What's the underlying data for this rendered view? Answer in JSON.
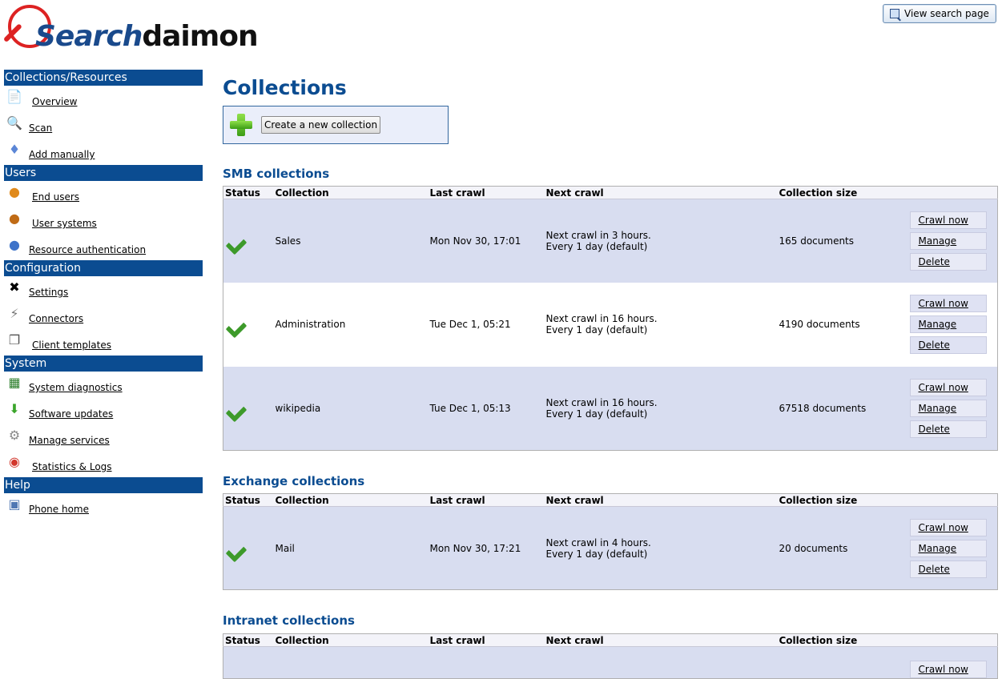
{
  "header": {
    "logo_text_1": "Search",
    "logo_text_2": "daimon",
    "view_search_label": "View search page"
  },
  "sidebar": {
    "sections": [
      {
        "title": "Collections/Resources",
        "items": [
          "Overview",
          "Scan",
          "Add manually"
        ]
      },
      {
        "title": "Users",
        "items": [
          "End users",
          "User systems",
          "Resource authentication"
        ]
      },
      {
        "title": "Configuration",
        "items": [
          "Settings",
          "Connectors",
          "Client templates"
        ]
      },
      {
        "title": "System",
        "items": [
          "System diagnostics",
          "Software updates",
          "Manage services",
          "Statistics & Logs"
        ]
      },
      {
        "title": "Help",
        "items": [
          "Phone home"
        ]
      }
    ]
  },
  "main": {
    "title": "Collections",
    "create_label": "Create a new collection",
    "columns": [
      "Status",
      "Collection",
      "Last crawl",
      "Next crawl",
      "Collection size"
    ],
    "actions": {
      "crawl": "Crawl now",
      "manage": "Manage",
      "delete": "Delete"
    },
    "smb": {
      "title": "SMB collections",
      "rows": [
        {
          "name": "Sales",
          "last": "Mon Nov 30, 17:01",
          "next1": "Next crawl in 3 hours.",
          "next2": "Every 1 day (default)",
          "size": "165 documents"
        },
        {
          "name": "Administration",
          "last": "Tue Dec 1, 05:21",
          "next1": "Next crawl in 16 hours.",
          "next2": "Every 1 day (default)",
          "size": "4190 documents"
        },
        {
          "name": "wikipedia",
          "last": "Tue Dec 1, 05:13",
          "next1": "Next crawl in 16 hours.",
          "next2": "Every 1 day (default)",
          "size": "67518 documents"
        }
      ]
    },
    "exchange": {
      "title": "Exchange collections",
      "rows": [
        {
          "name": "Mail",
          "last": "Mon Nov 30, 17:21",
          "next1": "Next crawl in 4 hours.",
          "next2": "Every 1 day (default)",
          "size": "20 documents"
        }
      ]
    },
    "intranet": {
      "title": "Intranet collections"
    }
  }
}
